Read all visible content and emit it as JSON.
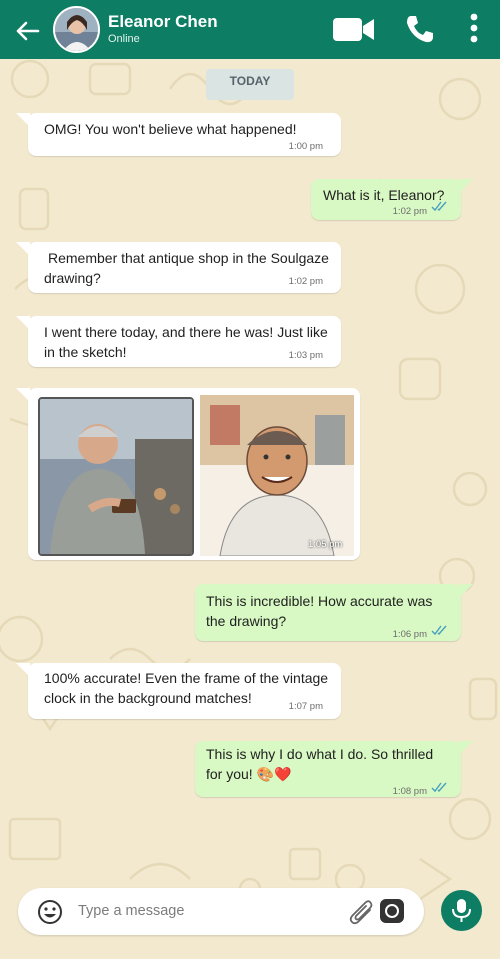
{
  "header": {
    "contact_name": "Eleanor Chen",
    "status": "Online",
    "colors": {
      "bar": "#0d7d63",
      "text": "#ffffff"
    },
    "icons": [
      "back-arrow-icon",
      "video-call-icon",
      "voice-call-icon",
      "more-options-icon"
    ]
  },
  "date_label": "TODAY",
  "messages": [
    {
      "dir": "in",
      "text": "OMG! You won't believe what happened!",
      "time": "1:00 pm"
    },
    {
      "dir": "out",
      "text": "What is it, Eleanor?",
      "time": "1:02 pm",
      "status": "read"
    },
    {
      "dir": "in",
      "text_lines": [
        "Remember that antique shop in the Soulgaze",
        "drawing?"
      ],
      "time": "1:02 pm"
    },
    {
      "dir": "in",
      "text_lines": [
        "I went there today, and there he was! Just like",
        "in the sketch!"
      ],
      "time": "1:03 pm"
    },
    {
      "dir": "in",
      "type": "photos",
      "photos": [
        "man-at-antique-shop-photo",
        "sketch-portrait"
      ],
      "time": "1:05 pm"
    },
    {
      "dir": "out",
      "text_lines": [
        "This is incredible! How accurate was",
        "the drawing?"
      ],
      "time": "1:06 pm",
      "status": "read"
    },
    {
      "dir": "in",
      "text_lines": [
        "100% accurate! Even the frame of the vintage",
        "clock in the background matches!"
      ],
      "time": "1:07 pm"
    },
    {
      "dir": "out",
      "text_lines": [
        "This is why I do what I do. So thrilled",
        "for you! 🎨❤️"
      ],
      "time": "1:08 pm",
      "status": "read"
    }
  ],
  "composer": {
    "placeholder": "Type a message",
    "icons": [
      "emoji-icon",
      "attach-icon",
      "camera-icon",
      "microphone-icon"
    ]
  },
  "colors": {
    "incoming": "#ffffff",
    "outgoing": "#d8f8c4",
    "accent": "#0d7d63",
    "read_ticks": "#34b7f1"
  }
}
